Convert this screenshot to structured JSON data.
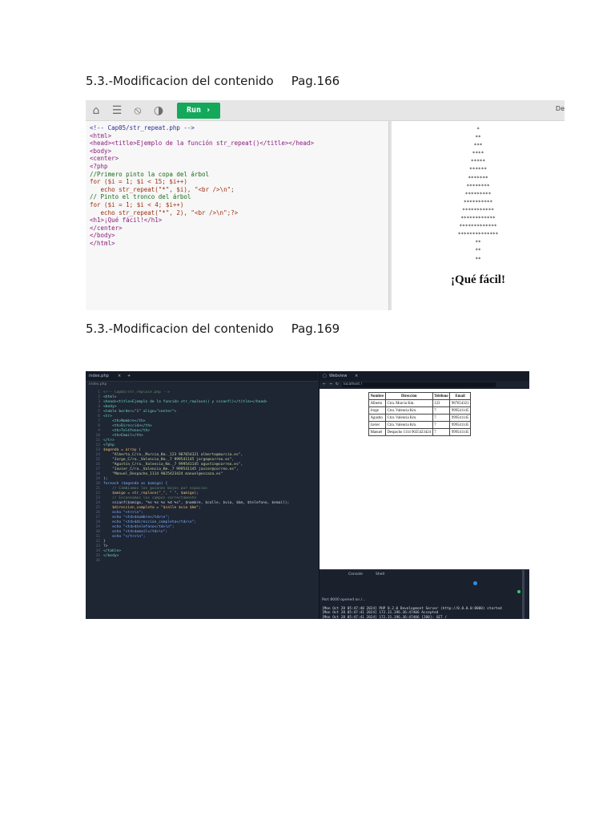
{
  "headings": [
    {
      "title": "5.3.-Modificacion del contenido",
      "page": "Pag.166"
    },
    {
      "title": "5.3.-Modificacion del contenido",
      "page": "Pag.169"
    }
  ],
  "editor1": {
    "run_label": "Run ›",
    "right_label": "De",
    "code_lines": [
      "<!-- Cap05/str_repeat.php -->",
      "<html>",
      "<head><title>Ejemplo de la función str_repeat()</title></head>",
      "<body>",
      "<center>",
      "<?php",
      "//Primero pinto la copa del árbol",
      "for ($i = 1; $i < 15; $i++)",
      "   echo str_repeat(\"*\", $i), \"<br />\\n\";",
      "// Pinto el tronco del árbol",
      "for ($i = 1; $i < 4; $i++)",
      "   echo str_repeat(\"*\", 2), \"<br />\\n\";?>",
      "<h1>¡Qué fácil!</h1>",
      "</center>",
      "</body>",
      "</html>"
    ],
    "tree_rows": [
      "*",
      "**",
      "***",
      "****",
      "*****",
      "******",
      "*******",
      "********",
      "*********",
      "**********",
      "***********",
      "************",
      "*************",
      "**************",
      "**",
      "**",
      "**"
    ],
    "output_heading": "¡Qué fácil!"
  },
  "ide2": {
    "editor_tab": "index.php",
    "editor_path": "index.php",
    "line_numbers": [
      "1",
      "2",
      "3",
      "4",
      "5",
      "6",
      "7",
      "8",
      "9",
      "10",
      "11",
      "12",
      "13",
      "14",
      "15",
      "16",
      "17",
      "18",
      "19",
      "20",
      "21",
      "22",
      "23",
      "24",
      "25",
      "26",
      "27",
      "28",
      "29",
      "30",
      "31",
      "32",
      "33",
      "34",
      "35",
      "36"
    ],
    "code_lines": [
      "<!-- Cap05/str_replace.php -->",
      "<html>",
      "<head><title>Ejemplo de la función str_replace() y sscanf()</title></head>",
      "<body>",
      "<table border=\"1\" align=\"center\">",
      "<tr>",
      "    <th>Nombre</th>",
      "    <th>Dirección</th>",
      "    <th>Teléfono</th>",
      "    <th>Email</th>",
      "</tr>",
      "<?php",
      "$agenda = array (",
      "    \"Alberto_C/ra._Murcia_Km._123 987654321 alberto@murcia.es\",",
      "    \"Jorge_C/ra._Valencia_Km._7 999541145 jorge@correo.es\",",
      "    \"Agustín_C/ra._Valencia_Km._7 999541145 agustin@correo.es\",",
      "    \"Javier_C/ra._Valencia_Km._7 999541145 javier@correo.es\",",
      "    \"Manuel_Despacho_1114 9025423424 manuel@escaza.es\"",
      ");",
      "",
      "foreach ($agenda as $amigo) {",
      "    // Cambiamos los guiones bajos por espacios",
      "    $amigo = str_replace(\"_\", \" \", $amigo);",
      "    // Escaneamos los campos correctamente",
      "    sscanf($amigo, \"%s %s %s %d %s\", $nombre, $calle, $via, $km, $telefono, $email);",
      "    $direccion_completa = \"$calle $via $km\";",
      "    echo \"<tr>\\n\";",
      "    echo \"<td>$nombre</td>\\n\";",
      "    echo \"<td>$direccion_completa</td>\\n\";",
      "    echo \"<td>$telefono</td>\\n\";",
      "    echo \"<td>$email</td>\\n\";",
      "    echo \"</tr>\\n\";",
      "}",
      "?>",
      "</table>",
      "</body>"
    ],
    "webview_tab": "Webview",
    "url": "localhost /",
    "table_headers": [
      "Nombre",
      "Dirección",
      "Teléfono",
      "Email"
    ],
    "table_rows": [
      [
        "Alberto",
        "Ctra. Murcia Km.",
        "123",
        "987654321"
      ],
      [
        "Jorge",
        "Ctra. Valencia Km.",
        "7",
        "999541145"
      ],
      [
        "Agustín",
        "Ctra. Valencia Km.",
        "7",
        "999541145"
      ],
      [
        "Javier",
        "Ctra. Valencia Km.",
        "7",
        "999541145"
      ],
      [
        "Manuel",
        "Despacho 1114 9025423424",
        "7",
        "999541145"
      ]
    ],
    "terminal_tabs": [
      "Console",
      "Shell"
    ],
    "status_text": "Port 8000 opened on /...",
    "log_lines": [
      "[Mon Oct 28 05:47:40 2024] PHP 8.2.0 Development Server (http://0.0.0.0:8000) started",
      "[Mon Oct 28 05:47:41 2024] 172.31.196.36:47406 Accepted",
      "[Mon Oct 28 05:47:41 2024] 172.31.196.36:47406 [200]: GET /"
    ]
  }
}
